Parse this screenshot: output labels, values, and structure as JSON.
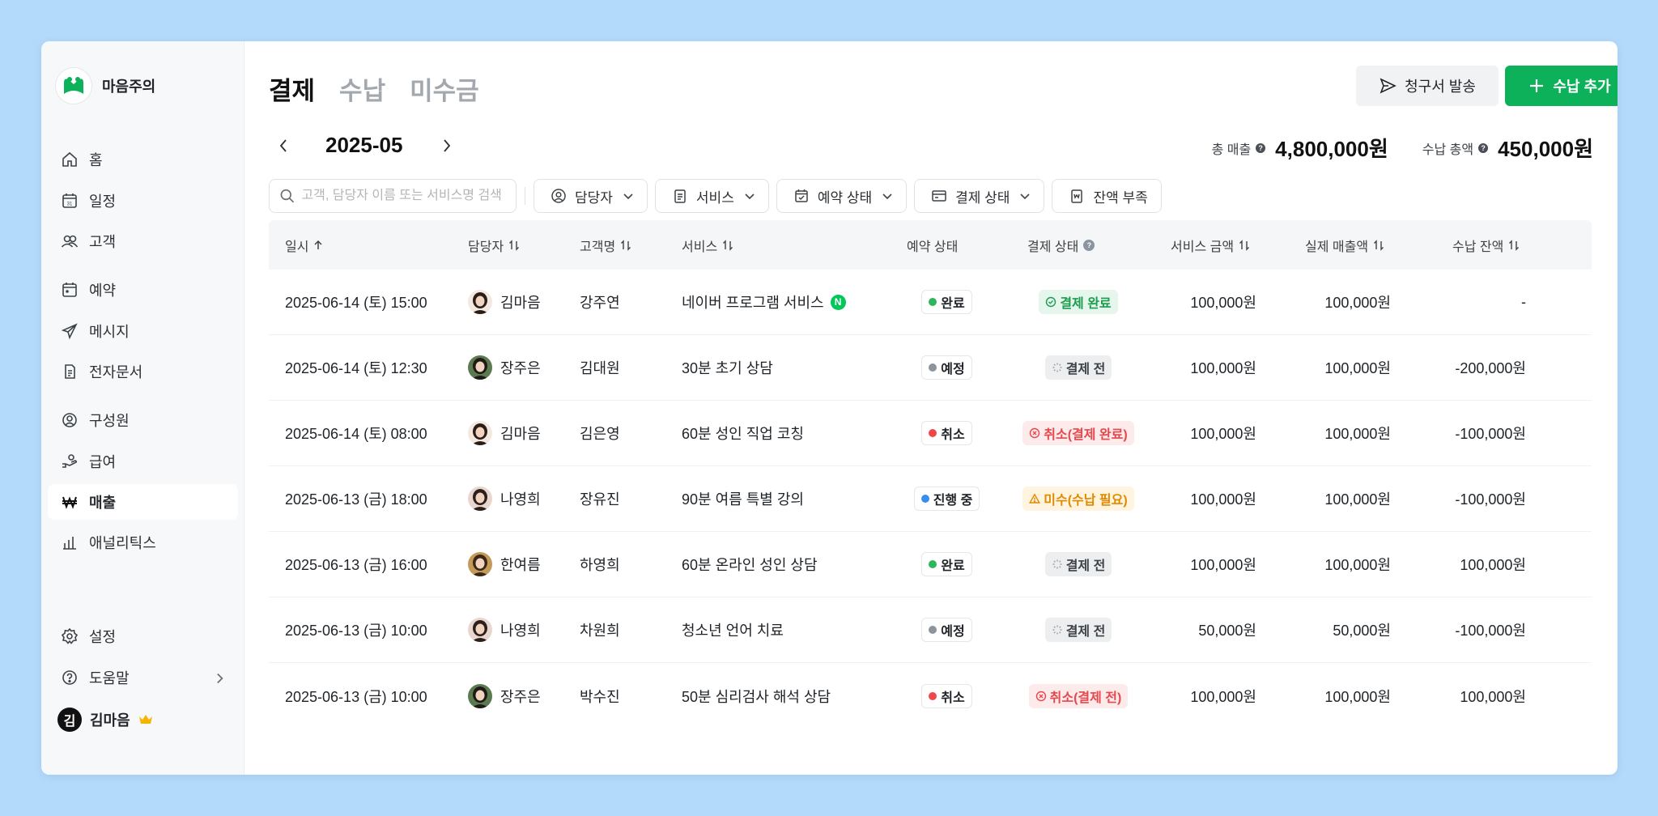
{
  "sidebar": {
    "brand": "마음주의",
    "brand_color": "#0cb15a",
    "items": [
      {
        "label": "홈",
        "icon": "home-icon"
      },
      {
        "label": "일정",
        "icon": "calendar-icon"
      },
      {
        "label": "고객",
        "icon": "users-icon"
      },
      {
        "label": "예약",
        "icon": "reservation-icon"
      },
      {
        "label": "메시지",
        "icon": "send-icon"
      },
      {
        "label": "전자문서",
        "icon": "document-icon"
      },
      {
        "label": "구성원",
        "icon": "member-icon"
      },
      {
        "label": "급여",
        "icon": "salary-icon"
      },
      {
        "label": "매출",
        "icon": "won-icon",
        "active": true
      },
      {
        "label": "애널리틱스",
        "icon": "analytics-icon"
      },
      {
        "label": "설정",
        "icon": "gear-icon"
      },
      {
        "label": "도움말",
        "icon": "help-icon"
      }
    ],
    "user": {
      "initial": "김",
      "name": "김마음"
    }
  },
  "header": {
    "tabs": [
      "결제",
      "수납",
      "미수금"
    ],
    "active_tab": "결제",
    "send_button": "청구서 발송",
    "add_button": "수납 추가"
  },
  "period": {
    "month": "2025-05"
  },
  "totals": {
    "sales_label": "총 매출",
    "sales_value": "4,800,000원",
    "collected_label": "수납 총액",
    "collected_value": "450,000원"
  },
  "filters": {
    "search_placeholder": "고객, 담당자 이름 또는 서비스명 검색",
    "staff": "담당자",
    "service": "서비스",
    "reservation_status": "예약 상태",
    "payment_status": "결제 상태",
    "low_balance": "잔액 부족"
  },
  "table": {
    "columns": [
      "일시",
      "담당자",
      "고객명",
      "서비스",
      "예약 상태",
      "결제 상태",
      "서비스 금액",
      "실제 매출액",
      "수납 잔액"
    ],
    "rows": [
      {
        "datetime": "2025-06-14 (토) 15:00",
        "staff": "김마음",
        "customer": "강주연",
        "service": "네이버 프로그램 서비스",
        "naver": true,
        "reservation": "완료",
        "res_color": "#2fb55a",
        "payment": "결제 완료",
        "pay_type": "done",
        "amount": "100,000원",
        "actual": "100,000원",
        "balance": "-"
      },
      {
        "datetime": "2025-06-14 (토) 12:30",
        "staff": "장주은",
        "customer": "김대원",
        "service": "30분 초기 상담",
        "naver": false,
        "reservation": "예정",
        "res_color": "#8c959d",
        "payment": "결제 전",
        "pay_type": "pending",
        "amount": "100,000원",
        "actual": "100,000원",
        "balance": "-200,000원"
      },
      {
        "datetime": "2025-06-14 (토) 08:00",
        "staff": "김마음",
        "customer": "김은영",
        "service": "60분 성인 직업 코칭",
        "naver": false,
        "reservation": "취소",
        "res_color": "#f04848",
        "payment": "취소(결제 완료)",
        "pay_type": "cancel",
        "amount": "100,000원",
        "actual": "100,000원",
        "balance": "-100,000원"
      },
      {
        "datetime": "2025-06-13 (금) 18:00",
        "staff": "나영희",
        "customer": "장유진",
        "service": "90분 여름 특별 강의",
        "naver": false,
        "reservation": "진행 중",
        "res_color": "#3b8cf0",
        "payment": "미수(수납 필요)",
        "pay_type": "unpaid",
        "amount": "100,000원",
        "actual": "100,000원",
        "balance": "-100,000원"
      },
      {
        "datetime": "2025-06-13 (금) 16:00",
        "staff": "한여름",
        "customer": "하영희",
        "service": "60분 온라인 성인 상담",
        "naver": false,
        "reservation": "완료",
        "res_color": "#2fb55a",
        "payment": "결제 전",
        "pay_type": "pending",
        "amount": "100,000원",
        "actual": "100,000원",
        "balance": "100,000원"
      },
      {
        "datetime": "2025-06-13 (금) 10:00",
        "staff": "나영희",
        "customer": "차원희",
        "service": "청소년 언어 치료",
        "naver": false,
        "reservation": "예정",
        "res_color": "#8c959d",
        "payment": "결제 전",
        "pay_type": "pending",
        "amount": "50,000원",
        "actual": "50,000원",
        "balance": "-100,000원"
      },
      {
        "datetime": "2025-06-13 (금) 10:00",
        "staff": "장주은",
        "customer": "박수진",
        "service": "50분 심리검사 해석 상담",
        "naver": false,
        "reservation": "취소",
        "res_color": "#f04848",
        "payment": "취소(결제 전)",
        "pay_type": "cancel",
        "amount": "100,000원",
        "actual": "100,000원",
        "balance": "100,000원"
      }
    ]
  }
}
